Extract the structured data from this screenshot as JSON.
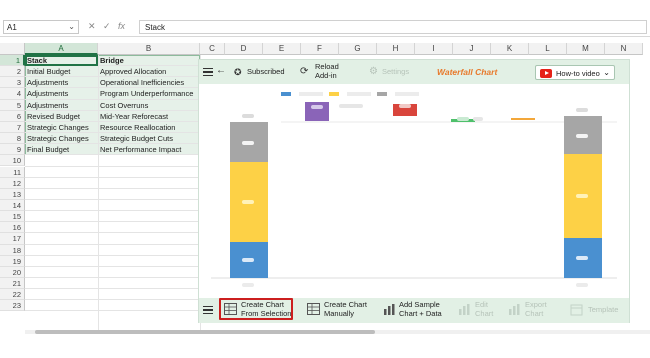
{
  "formula_bar": {
    "name_box": "A1",
    "name_box_chevron": "⌄",
    "cancel_icon": "✕",
    "enter_icon": "✓",
    "fx_label": "fx",
    "value": "Stack"
  },
  "columns": [
    "A",
    "B",
    "C",
    "D",
    "E",
    "F",
    "G",
    "H",
    "I",
    "J",
    "K",
    "L",
    "M",
    "N"
  ],
  "rows": [
    "1",
    "2",
    "3",
    "4",
    "5",
    "6",
    "7",
    "8",
    "9",
    "10",
    "11",
    "12",
    "13",
    "14",
    "15",
    "16",
    "17",
    "18",
    "19",
    "20",
    "21",
    "22",
    "23"
  ],
  "table": [
    [
      "Stack",
      "Bridge"
    ],
    [
      "Initial Budget",
      "Approved Allocation"
    ],
    [
      "Adjustments",
      "Operational Inefficiencies"
    ],
    [
      "Adjustments",
      "Program Underperformance"
    ],
    [
      "Adjustments",
      "Cost Overruns"
    ],
    [
      "Revised Budget",
      "Mid-Year Reforecast"
    ],
    [
      "Strategic Changes",
      "Resource Reallocation"
    ],
    [
      "Strategic Changes",
      "Strategic Budget Cuts"
    ],
    [
      "Final Budget",
      "Net Performance Impact"
    ]
  ],
  "addin": {
    "title": "Waterfall Chart",
    "toolbar": {
      "subscribed": "Subscribed",
      "reload_line1": "Reload",
      "reload_line2": "Add-in",
      "settings": "Settings",
      "howto": "How-to video",
      "howto_chevron": "⌄"
    },
    "bottom": {
      "create_sel_1": "Create Chart",
      "create_sel_2": "From Selection",
      "create_man_1": "Create Chart",
      "create_man_2": "Manually",
      "add_sample_1": "Add Sample",
      "add_sample_2": "Chart + Data",
      "edit_1": "Edit",
      "edit_2": "Chart",
      "export_1": "Export",
      "export_2": "Chart",
      "template": "Template"
    },
    "colors": {
      "blue": "#4a90d0",
      "yellow": "#fdd146",
      "gray": "#a6a6a6",
      "purple": "#8a64b8",
      "red": "#d9453c",
      "green": "#4ec06b",
      "orange": "#f3a73a"
    }
  }
}
